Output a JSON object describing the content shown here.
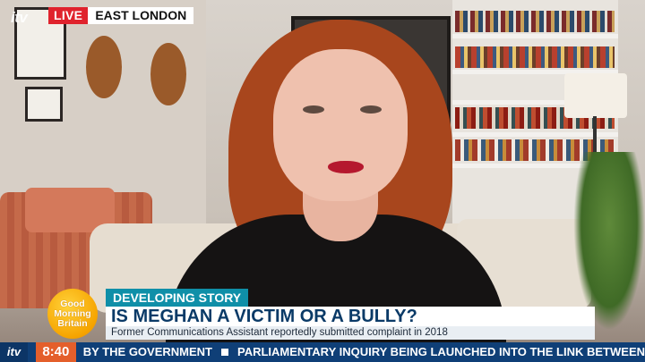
{
  "broadcast": {
    "channel_logo": "itv",
    "live_label": "LIVE",
    "location": "EAST LONDON"
  },
  "show_logo": {
    "line1": "Good",
    "line2": "Morning",
    "line3": "Britain"
  },
  "lower_third": {
    "story_label": "DEVELOPING STORY",
    "headline": "IS MEGHAN A VICTIM OR A BULLY?",
    "subline": "Former Communications Assistant reportedly submitted complaint in 2018"
  },
  "ticker": {
    "logo": "itv",
    "time": "8:40",
    "items": [
      "BY THE GOVERNMENT",
      "PARLIAMENTARY INQUIRY BEING LAUNCHED INTO THE LINK BETWEEN"
    ]
  },
  "colors": {
    "live_red": "#e0232d",
    "story_teal": "#0f8fa8",
    "headline_navy": "#0a3a67",
    "ticker_blue": "#0f3f77",
    "clock_orange": "#e45f2b"
  }
}
